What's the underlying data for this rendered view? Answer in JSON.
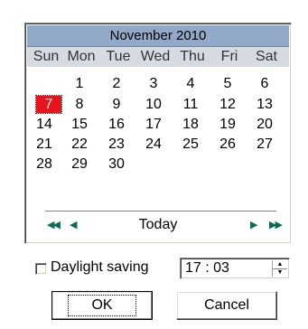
{
  "calendar": {
    "month_label": "November 2010",
    "weekdays": [
      "Sun",
      "Mon",
      "Tue",
      "Wed",
      "Thu",
      "Fri",
      "Sat"
    ],
    "weeks": [
      [
        "",
        "1",
        "2",
        "3",
        "4",
        "5",
        "6"
      ],
      [
        "7",
        "8",
        "9",
        "10",
        "11",
        "12",
        "13"
      ],
      [
        "14",
        "15",
        "16",
        "17",
        "18",
        "19",
        "20"
      ],
      [
        "21",
        "22",
        "23",
        "24",
        "25",
        "26",
        "27"
      ],
      [
        "28",
        "29",
        "30",
        "",
        "",
        "",
        ""
      ]
    ],
    "selected_day": "7",
    "selected_color": "#e8141c",
    "header_color": "#92a9c8",
    "nav": {
      "prev_year_icon": "double-left-arrow",
      "prev_month_icon": "left-arrow",
      "today_label": "Today",
      "next_month_icon": "right-arrow",
      "next_year_icon": "double-right-arrow"
    }
  },
  "daylight": {
    "label": "Daylight saving",
    "checked": false
  },
  "time": {
    "value": "17 : 03"
  },
  "buttons": {
    "ok_label": "OK",
    "cancel_label": "Cancel"
  }
}
